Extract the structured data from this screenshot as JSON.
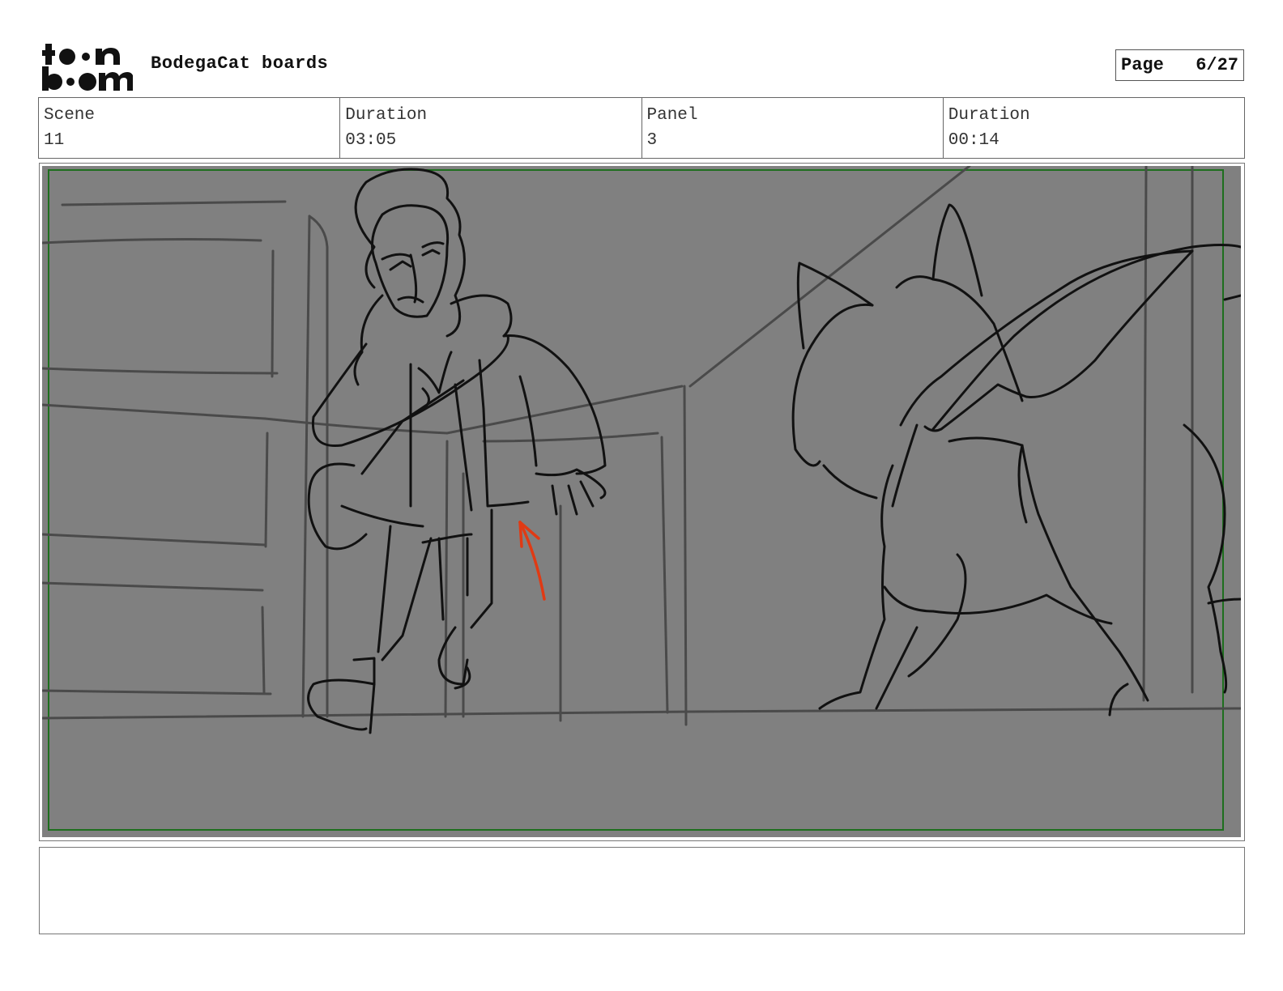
{
  "header": {
    "logo_text": "toon boom",
    "project_title": "BodegaCat boards",
    "page_label": "Page",
    "page_number": "6/27"
  },
  "info": {
    "scene_label": "Scene",
    "scene_value": "11",
    "scene_duration_label": "Duration",
    "scene_duration_value": "03:05",
    "panel_label": "Panel",
    "panel_value": "3",
    "panel_duration_label": "Duration",
    "panel_duration_value": "00:14"
  },
  "notes": {
    "text": ""
  },
  "colors": {
    "panel_background": "#808080",
    "safe_area_border": "#1e6e1e",
    "sketch_lines": "#111111",
    "background_lines": "#4a4a4a",
    "motion_arrow": "#e03a14"
  }
}
